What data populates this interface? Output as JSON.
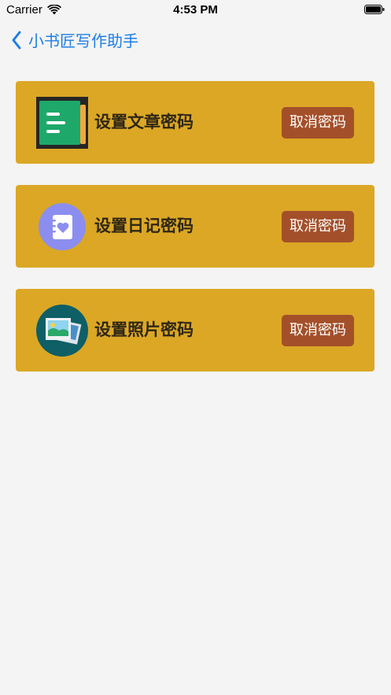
{
  "status_bar": {
    "carrier": "Carrier",
    "time": "4:53 PM",
    "wifi_icon": "wifi-icon",
    "battery_icon": "battery-full-icon"
  },
  "nav": {
    "back_icon": "chevron-left-icon",
    "title": "小书匠写作助手",
    "accent_color": "#1e7ee6"
  },
  "colors": {
    "background": "#f4f4f4",
    "card": "#dba725",
    "button": "#a3502a",
    "label": "#2e2616"
  },
  "cards": [
    {
      "icon": "document-icon",
      "label": "设置文章密码",
      "button": "取消密码"
    },
    {
      "icon": "diary-icon",
      "label": "设置日记密码",
      "button": "取消密码"
    },
    {
      "icon": "photos-icon",
      "label": "设置照片密码",
      "button": "取消密码"
    }
  ]
}
